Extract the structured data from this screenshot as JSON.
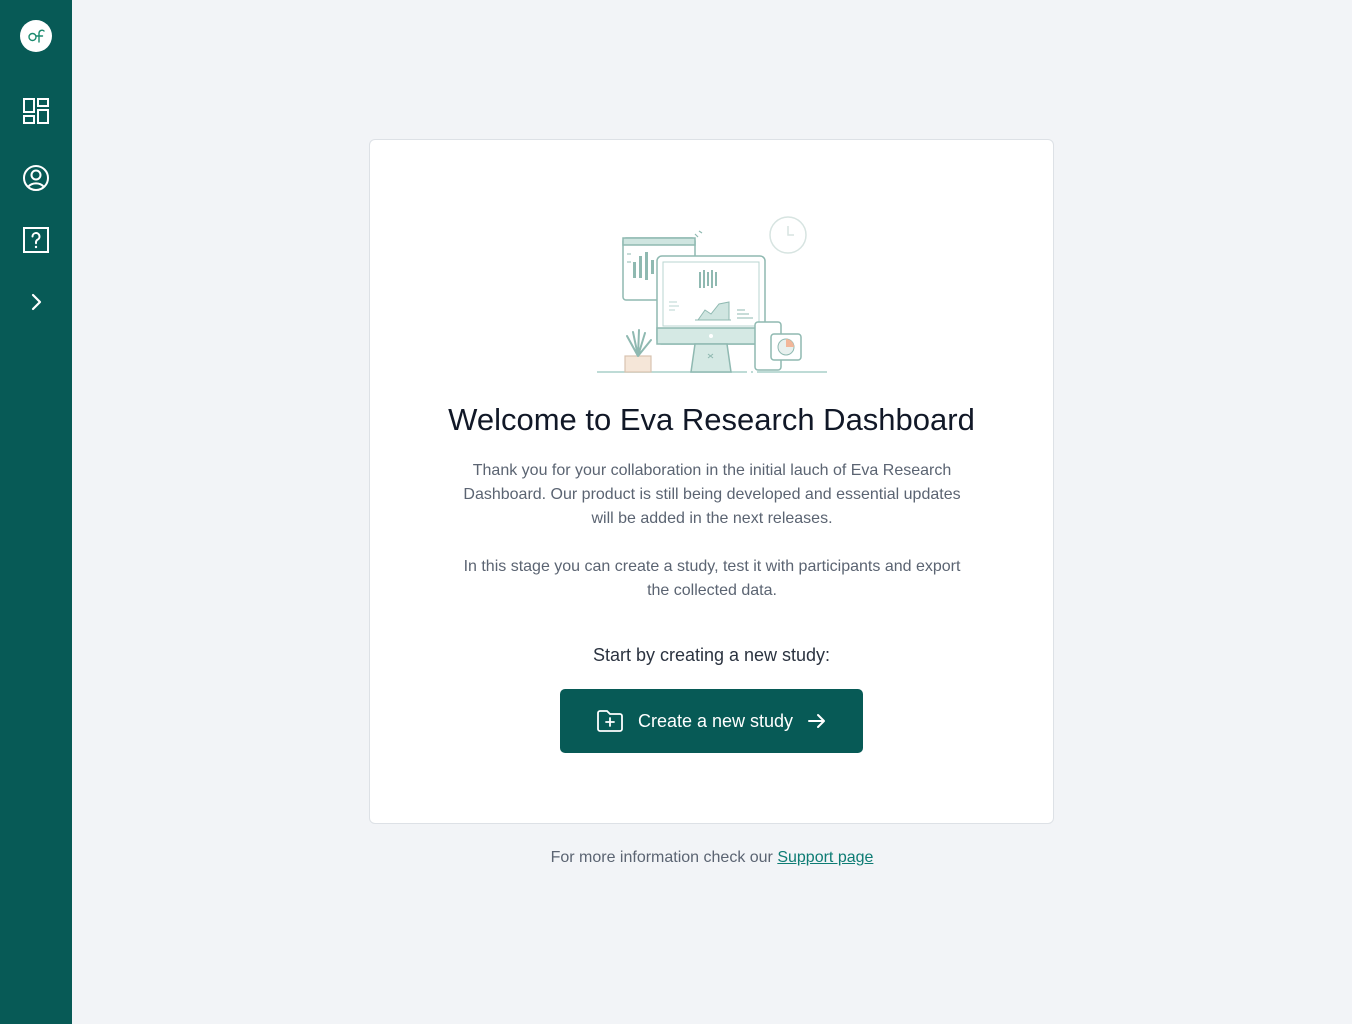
{
  "sidebar": {
    "logo": "of-logo-icon",
    "items": [
      {
        "icon": "dashboard-grid-icon"
      },
      {
        "icon": "user-circle-icon"
      },
      {
        "icon": "help-question-icon"
      },
      {
        "icon": "chevron-right-icon"
      }
    ]
  },
  "card": {
    "title": "Welcome to Eva Research Dashboard",
    "paragraph1": "Thank you for your collaboration in the initial lauch of Eva Research Dashboard. Our product is still being developed and essential updates will be added in the next releases.",
    "paragraph2": "In this stage you can create a study, test it with participants and export the collected data.",
    "prompt": "Start by creating a new study:",
    "cta_label": "Create a new study"
  },
  "footer": {
    "text": "For more information check our ",
    "link_label": "Support page"
  },
  "colors": {
    "sidebar": "#075a56",
    "accent": "#0e7c74",
    "background": "#f2f4f7"
  }
}
